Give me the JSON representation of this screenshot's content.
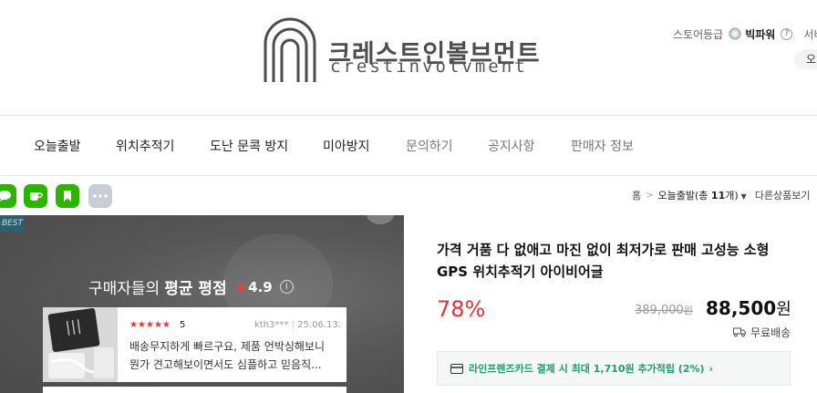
{
  "brand": {
    "name_kr": "크레스트인볼브먼트",
    "name_en": "crestinvolvment"
  },
  "store": {
    "grade_label": "스토어등급",
    "grade_name": "빅파워",
    "help": "?",
    "service_cut": "서비",
    "pill_cut": "오"
  },
  "nav": {
    "items": [
      {
        "label": "오늘출발"
      },
      {
        "label": "위치추적기"
      },
      {
        "label": "도난 문콕 방지"
      },
      {
        "label": "미아방지"
      },
      {
        "label": "문의하기"
      },
      {
        "label": "공지사항"
      },
      {
        "label": "판매자 정보"
      }
    ]
  },
  "share": {
    "buttons": [
      {
        "icon": "talk-icon",
        "color": "#2db400"
      },
      {
        "icon": "cafe-icon",
        "color": "#2db400"
      },
      {
        "icon": "blog-bookmark-icon",
        "color": "#2db400"
      },
      {
        "icon": "more-icon",
        "color": "#c9cdd6"
      }
    ]
  },
  "breadcrumb": {
    "home": "홈",
    "current": "오늘출발",
    "count_open": "(총 ",
    "count": "11",
    "count_unit": "개",
    "count_close": ")",
    "other": "다른상품보기"
  },
  "gallery": {
    "badge": "BEST",
    "rating_prefix": "구매자들의",
    "rating_strong": "평균 평점",
    "rating_star": "★",
    "rating_score": "4.9",
    "info": "i",
    "review": {
      "stars": "★★★★★",
      "score": "5",
      "author": "kth3***",
      "date": "25.06.13.",
      "text": "배송무지하게 빠르구요, 제품 언박싱해보니 뭔가 견고해보이면서도 심플하고 믿음직..."
    }
  },
  "product": {
    "title": "가격 거품 다 없애고 마진 없이 최저가로 판매 고성능 소형 GPS 위치추적기 아이비어글",
    "discount": "78%",
    "original_price": "389,000",
    "original_unit": "원",
    "sale_price": "88,500",
    "sale_unit": "원",
    "shipping": "무료배송",
    "card_benefit": "라인프렌즈카드 결제 시 최대 1,710원 추가적립 (2%)",
    "card_chevron": "›"
  },
  "colors": {
    "discount": "#e0343b",
    "benefit": "#1e9e6a",
    "star": "#f0302c"
  }
}
